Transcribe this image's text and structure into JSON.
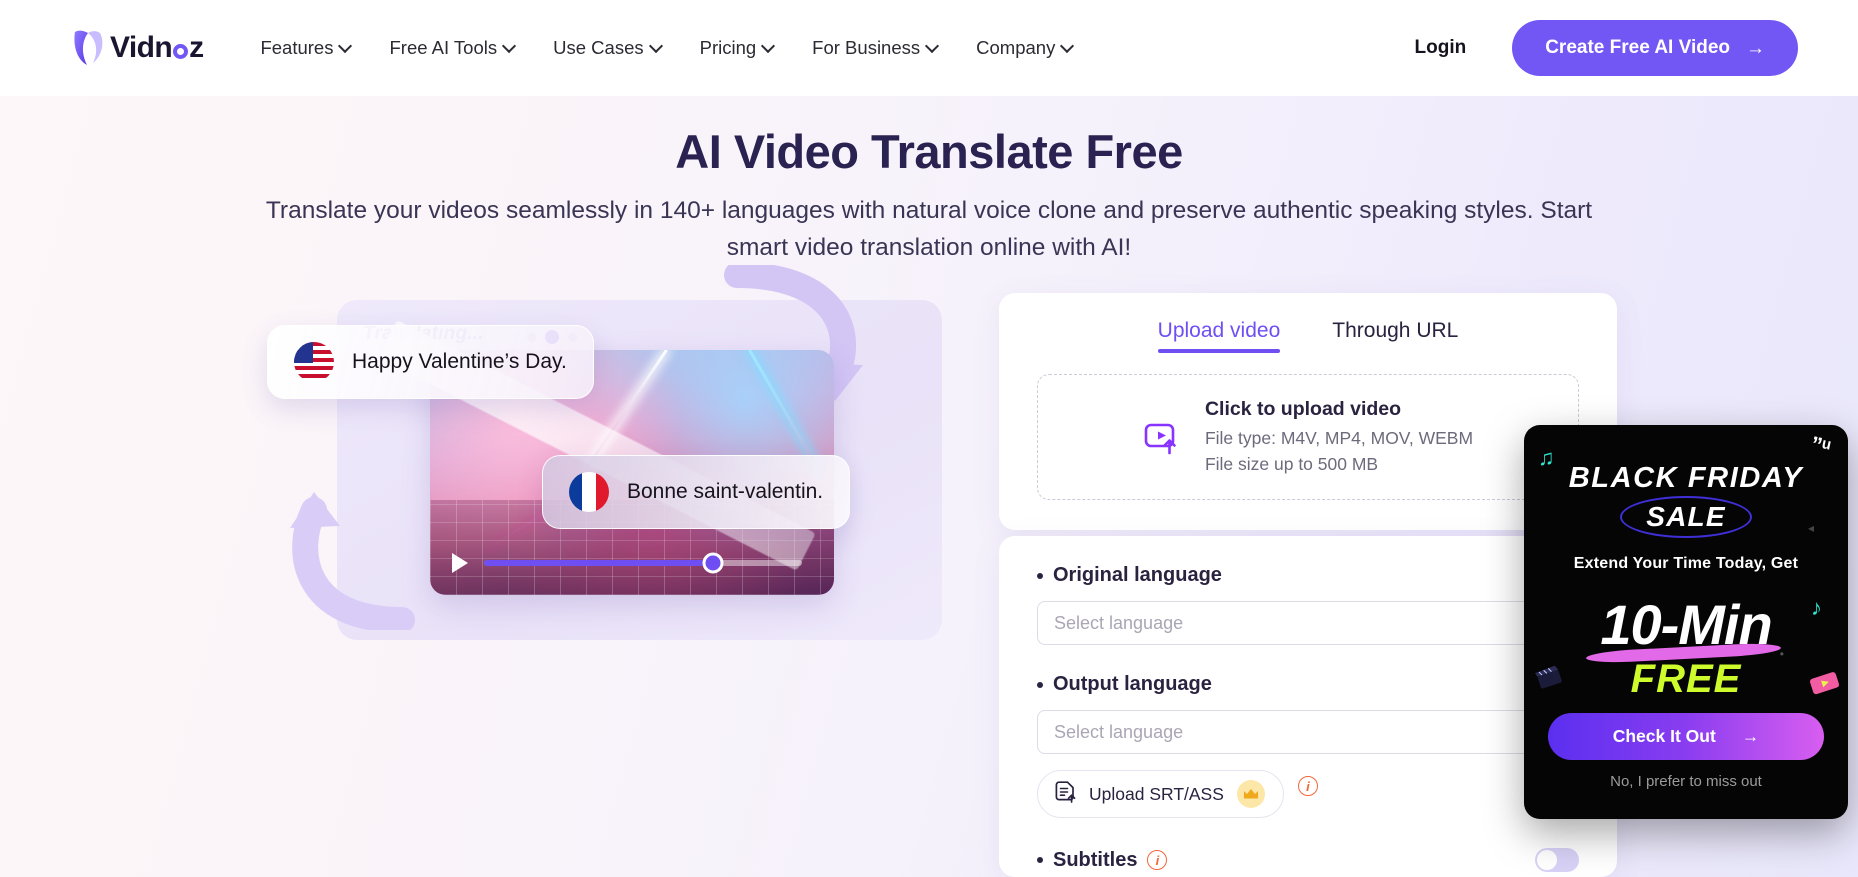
{
  "brand": {
    "name": "Vidnoz"
  },
  "nav": {
    "items": [
      {
        "label": "Features",
        "icon": "chevron-down-icon"
      },
      {
        "label": "Free AI Tools",
        "icon": "chevron-down-icon"
      },
      {
        "label": "Use Cases",
        "icon": "chevron-down-icon"
      },
      {
        "label": "Pricing",
        "icon": "chevron-down-icon"
      },
      {
        "label": "For Business",
        "icon": "chevron-down-icon"
      },
      {
        "label": "Company",
        "icon": "chevron-down-icon"
      }
    ],
    "login_label": "Login",
    "cta_label": "Create Free AI Video",
    "cta_arrow": "→",
    "cta_color": "#7257f5"
  },
  "hero": {
    "title": "AI Video Translate Free",
    "subtitle": "Translate your videos seamlessly in 140+ languages with natural voice clone and preserve authentic speaking styles. Start smart video translation online with AI!"
  },
  "illustration": {
    "status_label": "Translating...",
    "source_caption": "Happy Valentine’s Day.",
    "source_flag": "us-flag-icon",
    "target_caption": "Bonne saint-valentin.",
    "target_flag": "fr-flag-icon",
    "play_icon": "play-icon"
  },
  "panel": {
    "tabs": [
      {
        "label": "Upload video",
        "active": true
      },
      {
        "label": "Through URL",
        "active": false
      }
    ],
    "dropzone": {
      "icon": "video-upload-icon",
      "title": "Click to upload video",
      "file_type": "File type: M4V, MP4, MOV, WEBM",
      "file_size": "File size up to 500 MB"
    },
    "original_language": {
      "label": "Original language",
      "placeholder": "Select language",
      "value": ""
    },
    "output_language": {
      "label": "Output language",
      "placeholder": "Select language",
      "value": ""
    },
    "srt_button": {
      "label": "Upload SRT/ASS",
      "icon": "document-upload-icon",
      "badge_icon": "crown-icon",
      "info_icon": "info-icon"
    },
    "subtitles": {
      "label": "Subtitles",
      "info_icon": "info-icon",
      "toggle_on": false
    },
    "accent_color": "#6f4ff2"
  },
  "promo": {
    "title": "BLACK FRIDAY",
    "sale": "SALE",
    "subtitle": "Extend Your Time Today, Get",
    "headline": "10-Min",
    "free": "FREE",
    "cta_label": "Check It Out",
    "cta_arrow": "→",
    "dismiss_label": "No, I prefer to miss out",
    "free_color": "#cdfb2c",
    "background": "#050505"
  }
}
